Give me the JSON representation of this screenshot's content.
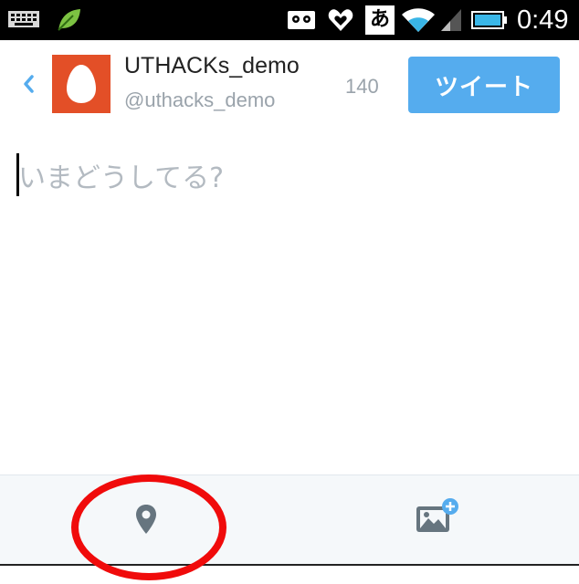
{
  "status_bar": {
    "ime_label": "あ",
    "time": "0:49",
    "icons": [
      "keyboard-icon",
      "leaf-icon",
      "tape-icon",
      "heart-icon",
      "ime-icon",
      "wifi-icon",
      "signal-icon",
      "battery-icon"
    ]
  },
  "header": {
    "back_icon": "chevron-left-icon",
    "display_name": "UTHACKs_demo",
    "handle": "@uthacks_demo",
    "char_count": "140",
    "tweet_label": "ツイート"
  },
  "compose": {
    "placeholder": "いまどうしてる?"
  },
  "toolbar": {
    "location_icon": "location-pin-icon",
    "photo_icon": "add-photo-icon"
  },
  "colors": {
    "accent": "#55acee",
    "avatar_bg": "#e34f27",
    "annotation": "#f00b0b",
    "muted_text": "#9aa3ab",
    "toolbar_bg": "#f5f8fa"
  }
}
